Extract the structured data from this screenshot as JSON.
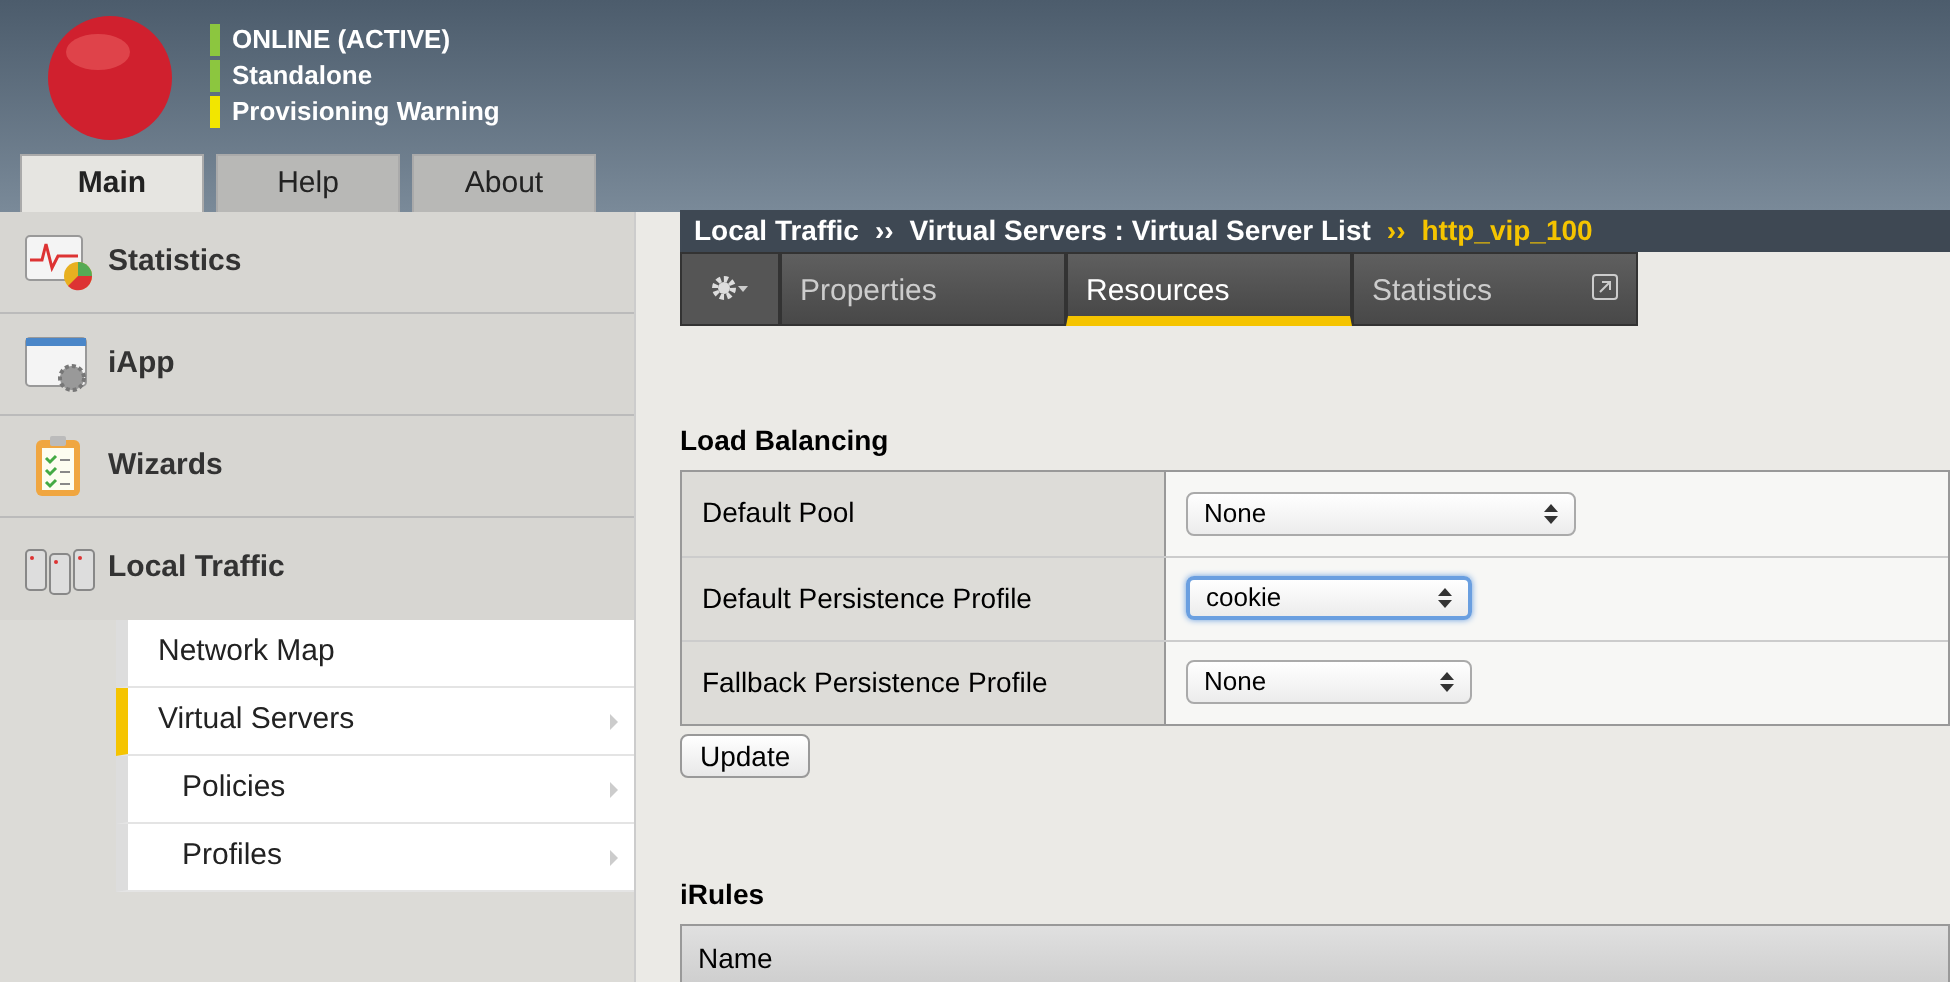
{
  "status": [
    {
      "label": "ONLINE (ACTIVE)",
      "color": "#8cc63f"
    },
    {
      "label": "Standalone",
      "color": "#8cc63f"
    },
    {
      "label": "Provisioning Warning",
      "color": "#f2e600"
    }
  ],
  "nav_tabs": [
    {
      "label": "Main",
      "selected": true
    },
    {
      "label": "Help",
      "selected": false
    },
    {
      "label": "About",
      "selected": false
    }
  ],
  "sidebar": {
    "items": [
      {
        "label": "Statistics",
        "kind": "chart"
      },
      {
        "label": "iApp",
        "kind": "app"
      },
      {
        "label": "Wizards",
        "kind": "clipboard"
      },
      {
        "label": "Local Traffic",
        "kind": "servers"
      }
    ],
    "sub_items": [
      {
        "label": "Network Map",
        "selected": false,
        "has_submenu": false,
        "indented": false
      },
      {
        "label": "Virtual Servers",
        "selected": true,
        "has_submenu": true,
        "indented": false
      },
      {
        "label": "Policies",
        "selected": false,
        "has_submenu": true,
        "indented": true
      },
      {
        "label": "Profiles",
        "selected": false,
        "has_submenu": true,
        "indented": true
      }
    ]
  },
  "breadcrumb": {
    "parts": [
      "Local Traffic",
      "Virtual Servers : Virtual Server List"
    ],
    "separator": "››",
    "current": "http_vip_100"
  },
  "content_tabs": [
    {
      "label": "Properties",
      "selected": false,
      "external": false
    },
    {
      "label": "Resources",
      "selected": true,
      "external": false
    },
    {
      "label": "Statistics",
      "selected": false,
      "external": true
    }
  ],
  "load_balancing": {
    "title": "Load Balancing",
    "rows": [
      {
        "label": "Default Pool",
        "value": "None",
        "focused": false,
        "wide": true
      },
      {
        "label": "Default Persistence Profile",
        "value": "cookie",
        "focused": true,
        "wide": false
      },
      {
        "label": "Fallback Persistence Profile",
        "value": "None",
        "focused": false,
        "wide": false
      }
    ],
    "button": "Update"
  },
  "irules": {
    "title": "iRules",
    "columns": [
      "Name"
    ]
  }
}
